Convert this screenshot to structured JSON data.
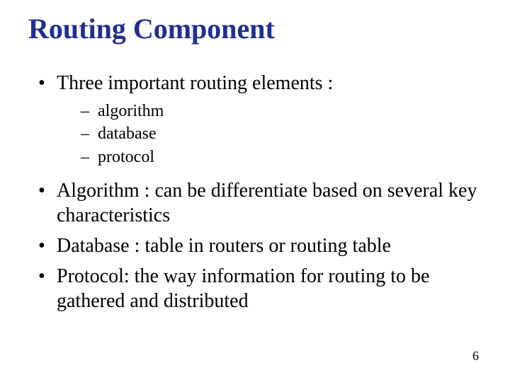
{
  "title": "Routing Component",
  "bullets": {
    "b0": "Three important routing elements :",
    "sub": {
      "s0": "algorithm",
      "s1": "database",
      "s2": "protocol"
    },
    "b1": "Algorithm : can be differentiate based on several key characteristics",
    "b2": "Database : table in routers or routing table",
    "b3": "Protocol: the way information for routing to be gathered and distributed"
  },
  "page_number": "6"
}
